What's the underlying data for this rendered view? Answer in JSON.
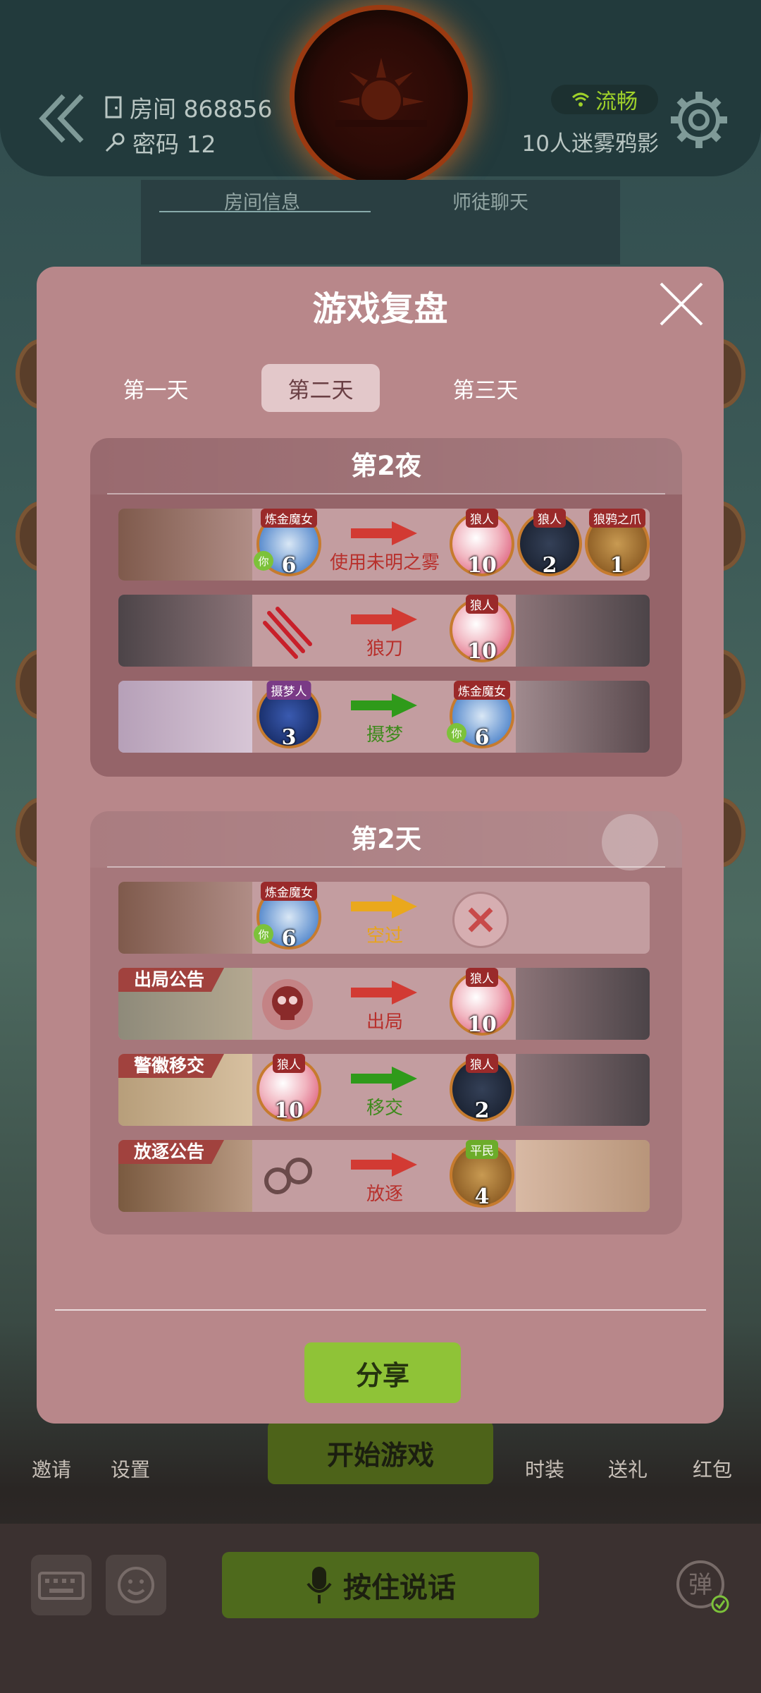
{
  "room": {
    "room_label": "房间 868856",
    "password_label": "密码 12",
    "network_status": "流畅",
    "mode_name": "10人迷雾鸦影",
    "tabs": [
      "房间信息",
      "师徒聊天"
    ]
  },
  "modal": {
    "title": "游戏复盘",
    "day_tabs": [
      "第一天",
      "第二天",
      "第三天"
    ],
    "active_tab": "第二天",
    "share_label": "分享",
    "night_section": {
      "title": "第2夜",
      "events": [
        {
          "actor": {
            "role": "炼金魔女",
            "seat": "6",
            "you": "你"
          },
          "action": "使用未明之雾",
          "action_color": "#d23a33",
          "targets": [
            {
              "role": "狼人",
              "seat": "10"
            },
            {
              "role": "狼人",
              "seat": "2"
            },
            {
              "role": "狼鸦之爪",
              "seat": "1"
            }
          ]
        },
        {
          "actor": null,
          "action": "狼刀",
          "action_color": "#d23a33",
          "targets": [
            {
              "role": "狼人",
              "seat": "10"
            }
          ]
        },
        {
          "actor": {
            "role": "摄梦人",
            "seat": "3"
          },
          "action": "摄梦",
          "action_color": "#2f9a1a",
          "targets": [
            {
              "role": "炼金魔女",
              "seat": "6",
              "you": "你"
            }
          ]
        }
      ]
    },
    "day_section": {
      "title": "第2天",
      "events": [
        {
          "actor": {
            "role": "炼金魔女",
            "seat": "6",
            "you": "你"
          },
          "action": "空过",
          "action_color": "#eaa81c",
          "targets": []
        },
        {
          "banner": "出局公告",
          "action": "出局",
          "action_color": "#d23a33",
          "targets": [
            {
              "role": "狼人",
              "seat": "10"
            }
          ]
        },
        {
          "banner": "警徽移交",
          "actor": {
            "role": "狼人",
            "seat": "10"
          },
          "action": "移交",
          "action_color": "#2f9a1a",
          "targets": [
            {
              "role": "狼人",
              "seat": "2"
            }
          ]
        },
        {
          "banner": "放逐公告",
          "action": "放逐",
          "action_color": "#d23a33",
          "targets": [
            {
              "role": "平民",
              "seat": "4"
            }
          ]
        }
      ]
    }
  },
  "bottom_bar": {
    "start_game": "开始游戏",
    "invite": "邀请",
    "settings": "设置",
    "costume": "时装",
    "gift": "送礼",
    "red_packet": "红包",
    "hold_to_talk": "按住说话",
    "danmu": "弹"
  },
  "icons": {
    "back": "chevron-double-left-icon",
    "door": "door-icon",
    "key": "key-icon",
    "wifi": "wifi-icon",
    "gear": "gear-icon",
    "close": "close-icon",
    "keyboard": "keyboard-icon",
    "emoji": "smile-icon",
    "mic": "microphone-icon"
  }
}
